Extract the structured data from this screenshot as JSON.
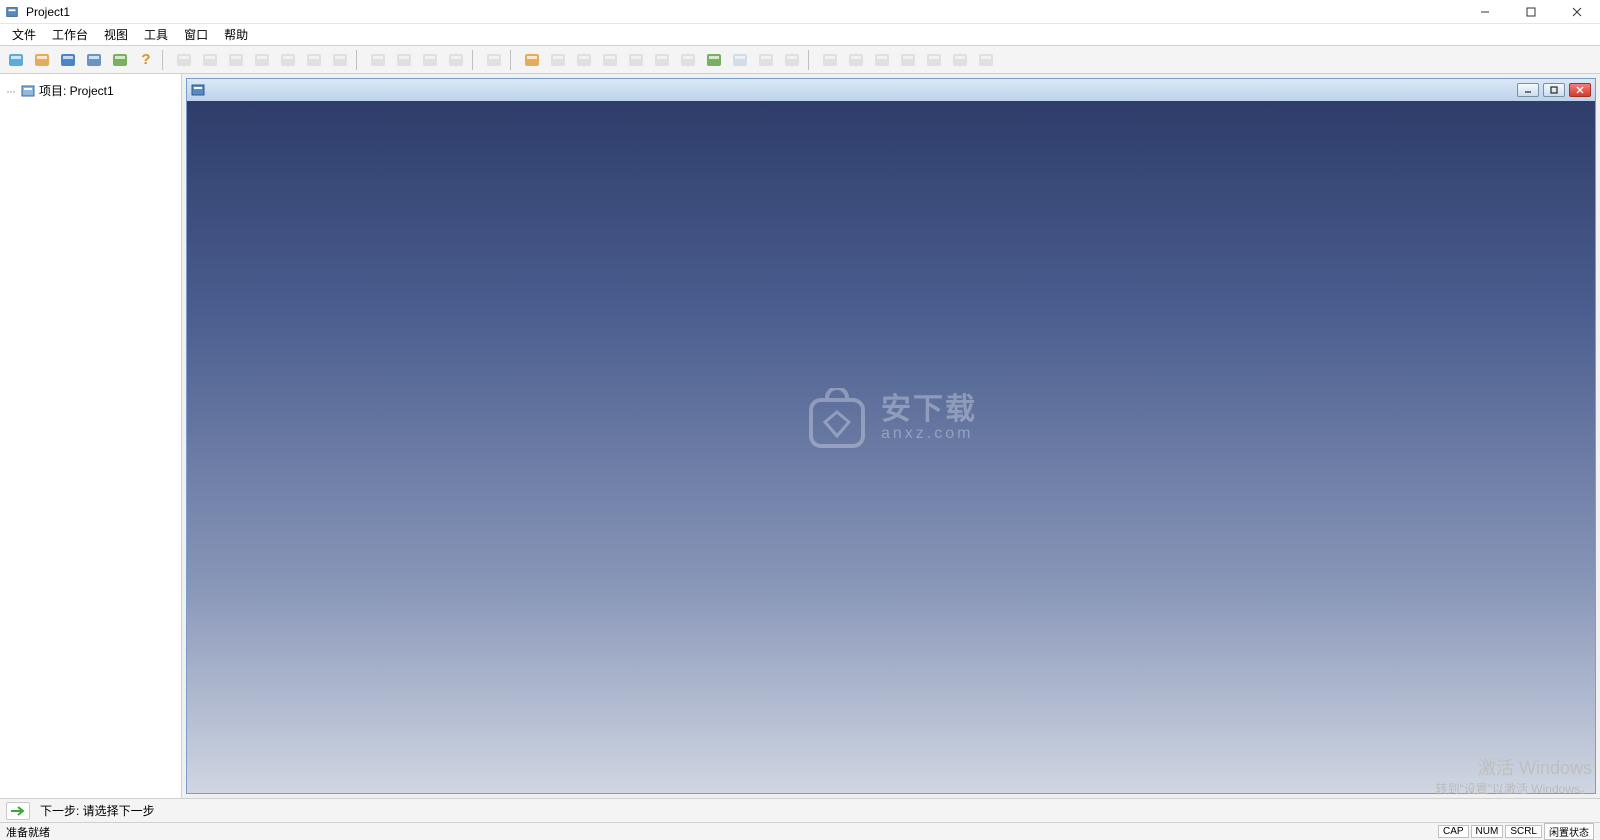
{
  "window": {
    "title": "Project1"
  },
  "menus": [
    {
      "id": "file",
      "label": "文件"
    },
    {
      "id": "workbench",
      "label": "工作台"
    },
    {
      "id": "view",
      "label": "视图"
    },
    {
      "id": "tools",
      "label": "工具"
    },
    {
      "id": "window",
      "label": "窗口"
    },
    {
      "id": "help",
      "label": "帮助"
    }
  ],
  "toolbar_groups": [
    [
      {
        "name": "new-icon",
        "color": "#4aa3df",
        "disabled": false
      },
      {
        "name": "open-folder-icon",
        "color": "#e2a54a",
        "disabled": false
      },
      {
        "name": "save-icon",
        "color": "#3a78c2",
        "disabled": false
      },
      {
        "name": "camera-icon",
        "color": "#5a8bc0",
        "disabled": false
      },
      {
        "name": "refresh-icon",
        "color": "#6aa84f",
        "disabled": false
      },
      {
        "name": "help-icon",
        "color": "#d98f2e",
        "disabled": false,
        "text": "?"
      }
    ],
    [
      {
        "name": "cut-icon",
        "color": "#999",
        "disabled": true
      },
      {
        "name": "zoom-in-icon",
        "color": "#999",
        "disabled": true
      },
      {
        "name": "zoom-out-icon",
        "color": "#999",
        "disabled": true
      },
      {
        "name": "axis-icon",
        "color": "#999",
        "disabled": true
      },
      {
        "name": "move-icon",
        "color": "#999",
        "disabled": true
      },
      {
        "name": "fit-icon",
        "color": "#999",
        "disabled": true
      },
      {
        "name": "grid-icon",
        "color": "#999",
        "disabled": true
      }
    ],
    [
      {
        "name": "box-icon",
        "color": "#999",
        "disabled": true
      },
      {
        "name": "mesh-icon",
        "color": "#999",
        "disabled": true
      },
      {
        "name": "measure-icon",
        "color": "#999",
        "disabled": true
      },
      {
        "name": "search-icon",
        "color": "#999",
        "disabled": true
      }
    ],
    [
      {
        "name": "filter-icon",
        "color": "#999",
        "disabled": true
      }
    ],
    [
      {
        "name": "folder2-icon",
        "color": "#e2a54a",
        "disabled": false
      },
      {
        "name": "link-icon",
        "color": "#999",
        "disabled": true
      },
      {
        "name": "chain-icon",
        "color": "#999",
        "disabled": true
      },
      {
        "name": "path-icon",
        "color": "#999",
        "disabled": true
      },
      {
        "name": "contact-icon",
        "color": "#999",
        "disabled": true
      },
      {
        "name": "bridge-icon",
        "color": "#999",
        "disabled": true
      },
      {
        "name": "pillar-icon",
        "color": "#999",
        "disabled": true
      },
      {
        "name": "panel-icon",
        "color": "#6aa84f",
        "disabled": false
      },
      {
        "name": "stack-icon",
        "color": "#5a8bc0",
        "disabled": true
      },
      {
        "name": "layers-icon",
        "color": "#999",
        "disabled": true
      },
      {
        "name": "slab-icon",
        "color": "#999",
        "disabled": true
      }
    ],
    [
      {
        "name": "grid2-icon",
        "color": "#999",
        "disabled": true
      },
      {
        "name": "copy-icon",
        "color": "#999",
        "disabled": true
      },
      {
        "name": "columns-icon",
        "color": "#999",
        "disabled": true
      },
      {
        "name": "tiles-icon",
        "color": "#999",
        "disabled": true
      },
      {
        "name": "rows-icon",
        "color": "#999",
        "disabled": true
      },
      {
        "name": "table-icon",
        "color": "#999",
        "disabled": true
      },
      {
        "name": "dim-icon",
        "color": "#999",
        "disabled": true
      }
    ]
  ],
  "tree": {
    "root_label": "项目: Project1"
  },
  "watermark": {
    "main": "安下载",
    "sub": "anxz.com"
  },
  "nextbar": {
    "text": "下一步: 请选择下一步"
  },
  "activation": {
    "line1": "激活 Windows",
    "line2": "转到\"设置\"以激活 Windows。"
  },
  "status": {
    "text": "准备就绪",
    "indicators": [
      "CAP",
      "NUM",
      "SCRL",
      "闲置状态"
    ]
  }
}
